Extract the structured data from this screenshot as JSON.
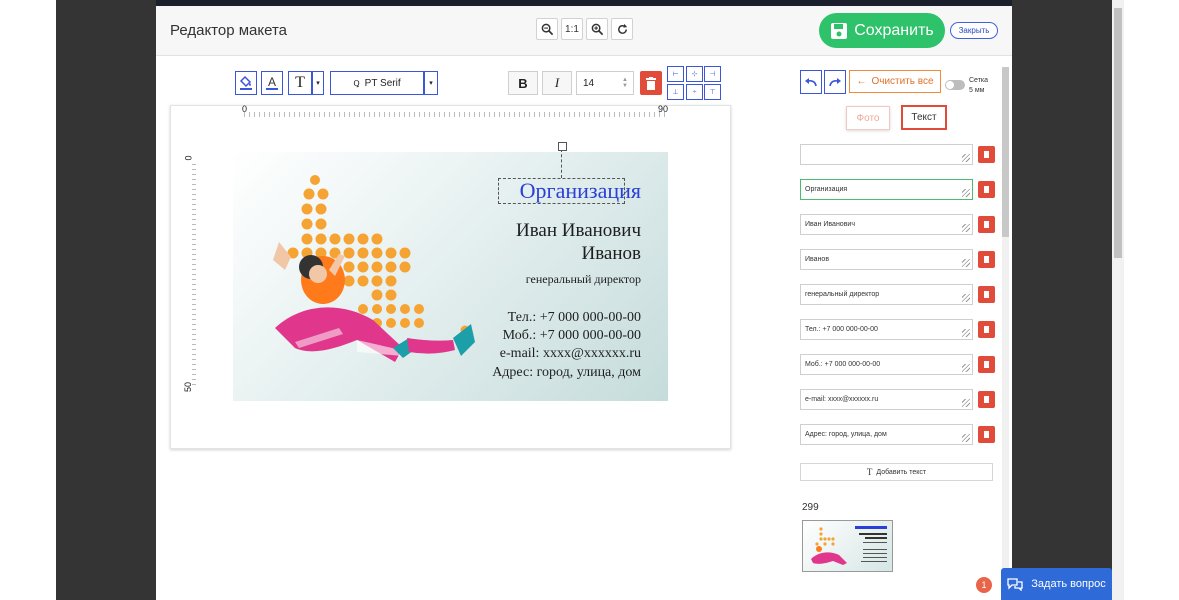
{
  "editor": {
    "title": "Редактор макета",
    "zoom_reset_label": "1:1",
    "save_label": "Сохранить",
    "close_label": "Закрыть"
  },
  "toolbar": {
    "font_family": "PT Serif",
    "font_size": "14",
    "bold_label": "B",
    "italic_label": "I",
    "text_tool_label": "T"
  },
  "ruler": {
    "h_start": "0",
    "h_end": "90",
    "v_start": "0",
    "v_end": "50"
  },
  "card": {
    "organization": "Организация",
    "first_line": "Иван Иванович",
    "second_line": "Иванов",
    "position": "генеральный директор",
    "phone": "Тел.: +7 000 000-00-00",
    "mobile": "Моб.: +7 000 000-00-00",
    "email": "e-mail: xxxx@xxxxxx.ru",
    "address": "Адрес: город, улица, дом",
    "organization_color": "#2a3fd8"
  },
  "side_panel": {
    "clear_all_label": "Очистить все",
    "grid_label_line1": "Сетка",
    "grid_label_line2": "5 мм",
    "tab_photo": "Фото",
    "tab_text": "Текст",
    "fields": [
      "",
      "Организация",
      "Иван Иванович",
      "Иванов",
      "генеральный директор",
      "Тел.: +7 000 000-00-00",
      "Моб.: +7 000 000-00-00",
      "e-mail: xxxx@xxxxxx.ru",
      "Адрес: город, улица, дом"
    ],
    "add_text_label": "Добавить текст",
    "template_number": "299"
  },
  "chat": {
    "label": "Задать вопрос",
    "badge": "1"
  },
  "colors": {
    "accent_blue": "#3b56d8",
    "save_green": "#2ec26b",
    "delete_red": "#e04b3a",
    "clear_orange": "#f08a3c",
    "dot_orange": "#f5a333",
    "outfit_pink": "#e0368c"
  }
}
